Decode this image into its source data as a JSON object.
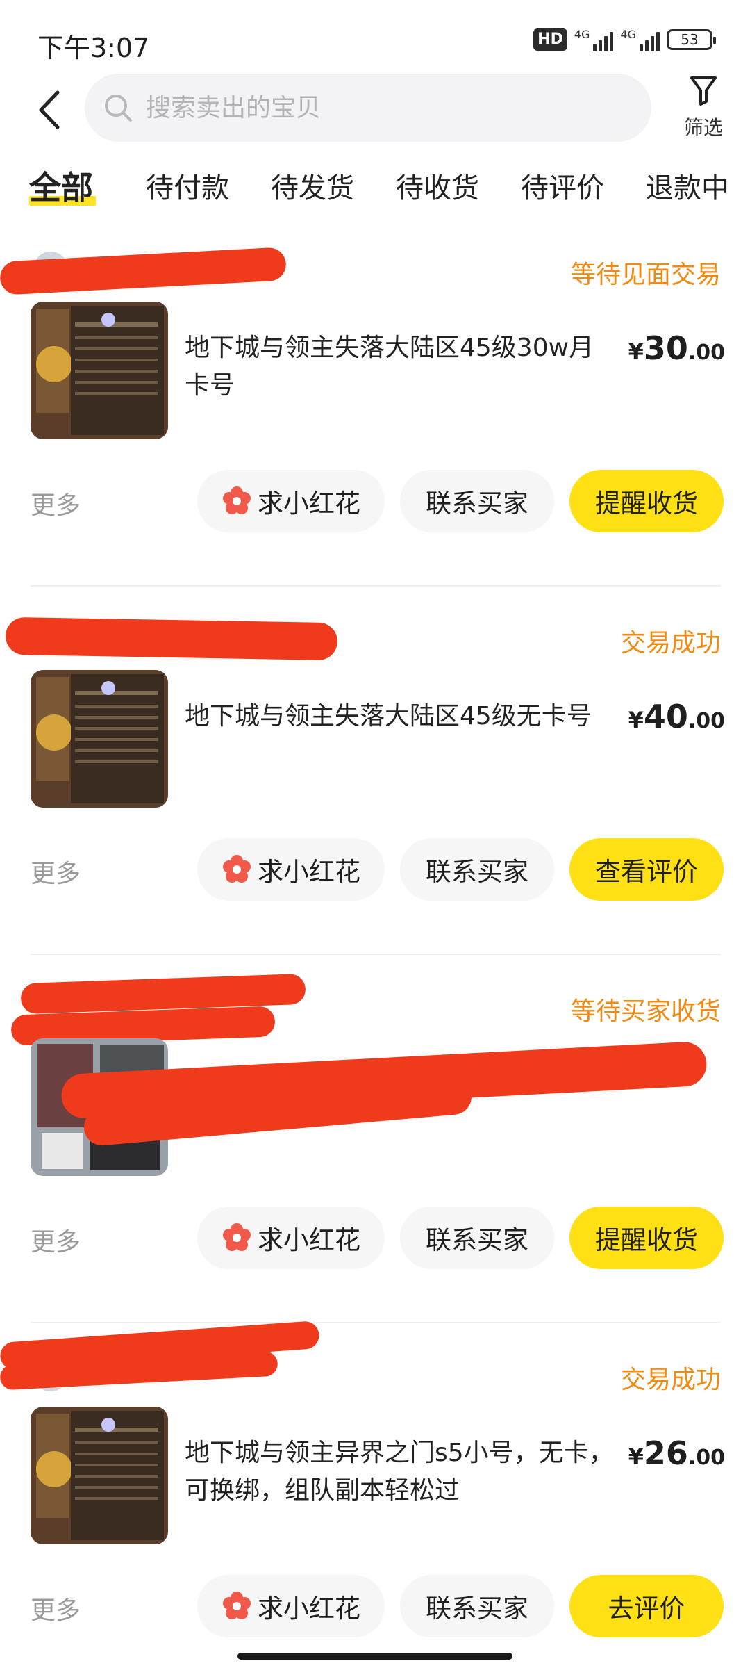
{
  "status_bar": {
    "time": "下午3:07",
    "hd": "HD",
    "net1": "4G",
    "net2": "4G",
    "battery": "53"
  },
  "header": {
    "search_placeholder": "搜索卖出的宝贝",
    "filter_label": "筛选"
  },
  "tabs": [
    {
      "label": "全部",
      "active": true
    },
    {
      "label": "待付款"
    },
    {
      "label": "待发货"
    },
    {
      "label": "待收货"
    },
    {
      "label": "待评价"
    },
    {
      "label": "退款中"
    }
  ],
  "orders": [
    {
      "seller": "",
      "status": "等待见面交易",
      "title": "地下城与领主失落大陆区45级30w月卡号",
      "price_symbol": "¥",
      "price_int": "30",
      "price_dec": ".00",
      "more": "更多",
      "btn_flower": "求小红花",
      "btn_contact": "联系买家",
      "btn_primary": "提醒收货"
    },
    {
      "seller": "",
      "status": "交易成功",
      "title": "地下城与领主失落大陆区45级无卡号",
      "price_symbol": "¥",
      "price_int": "40",
      "price_dec": ".00",
      "more": "更多",
      "btn_flower": "求小红花",
      "btn_contact": "联系买家",
      "btn_primary": "查看评价"
    },
    {
      "seller": "",
      "status": "等待买家收货",
      "title": "",
      "price_symbol": "",
      "price_int": "",
      "price_dec": "",
      "more": "更多",
      "btn_flower": "求小红花",
      "btn_contact": "联系买家",
      "btn_primary": "提醒收货"
    },
    {
      "seller": "",
      "status": "交易成功",
      "title": "地下城与领主异界之门s5小号，无卡，可换绑，组队副本轻松过",
      "price_symbol": "¥",
      "price_int": "26",
      "price_dec": ".00",
      "more": "更多",
      "btn_flower": "求小红花",
      "btn_contact": "联系买家",
      "btn_primary": "去评价"
    }
  ],
  "colors": {
    "accent_yellow": "#ffe014",
    "status_orange": "#f08a10",
    "redaction": "#ef3a1c"
  },
  "icons": [
    "back-arrow-icon",
    "search-icon",
    "filter-funnel-icon",
    "red-flower-icon"
  ]
}
